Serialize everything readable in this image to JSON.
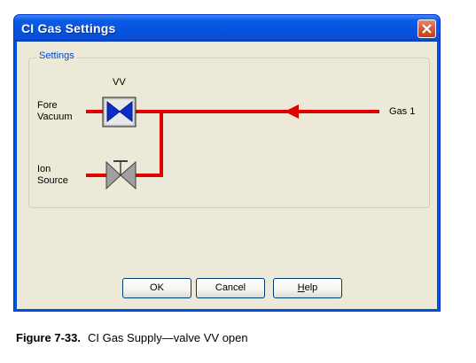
{
  "window": {
    "title": "CI Gas Settings",
    "close_label": "×"
  },
  "settings": {
    "group_label": "Settings",
    "valve_label": "VV",
    "fore_vacuum_line1": "Fore",
    "fore_vacuum_line2": "Vacuum",
    "ion_source_line1": "Ion",
    "ion_source_line2": "Source",
    "gas_label": "Gas 1",
    "valve_vv_state": "open",
    "ion_source_valve_state": "closed",
    "colors": {
      "gas_line": "#e00000",
      "valve_open": "#0a2fc8",
      "valve_closed": "#909090"
    }
  },
  "buttons": {
    "ok": "OK",
    "cancel": "Cancel",
    "help_prefix": "H",
    "help_rest": "elp"
  },
  "caption": {
    "figure_number": "Figure 7-33.",
    "text": "CI Gas Supply—valve VV open"
  }
}
